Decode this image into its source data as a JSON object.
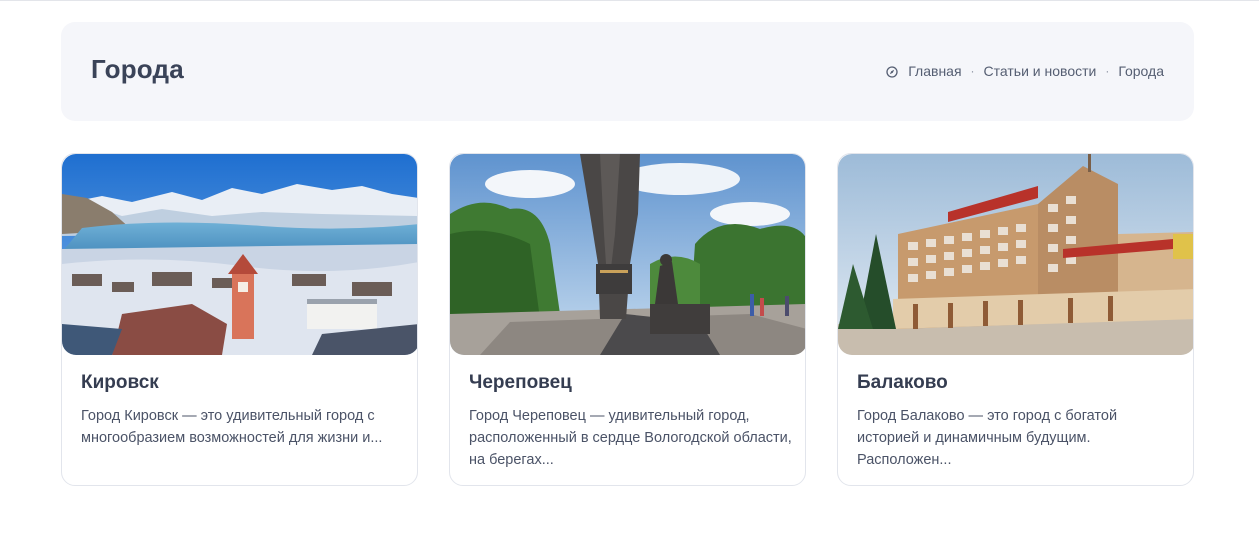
{
  "page": {
    "title": "Города"
  },
  "breadcrumb": {
    "icon": "compass-icon",
    "items": [
      {
        "label": "Главная"
      },
      {
        "label": "Статьи и новости"
      },
      {
        "label": "Города"
      }
    ],
    "separator": "·"
  },
  "cards": [
    {
      "title": "Кировск",
      "excerpt": "Город Кировск — это удивительный город с многообразием возможностей для жизни и...",
      "image": "photo of snowy mountains above a lake and town"
    },
    {
      "title": "Череповец",
      "excerpt": "Город Череповец — удивительный город, расположенный в сердце Вологодской области, на берегах...",
      "image": "photo of a monument on a city square with trees"
    },
    {
      "title": "Балаково",
      "excerpt": "Город Балаково — это город с богатой историей и динамичным будущим. Расположен...",
      "image": "photo of a hotel building with a rooftop sign"
    }
  ],
  "colors": {
    "hero_background": "#f5f6fa",
    "heading": "#3a4358",
    "body_text": "#4b5367",
    "card_border": "#e2e5ec"
  }
}
